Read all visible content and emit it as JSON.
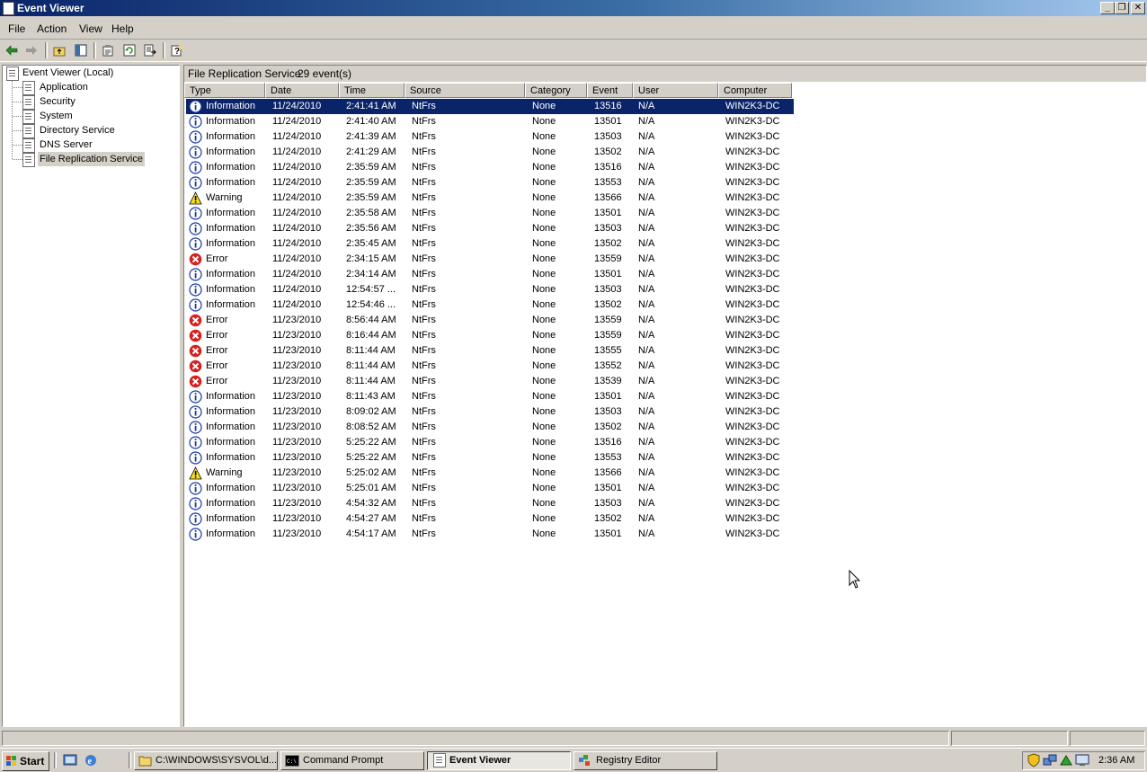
{
  "window": {
    "title": "Event Viewer"
  },
  "menu": [
    "File",
    "Action",
    "View",
    "Help"
  ],
  "tree": {
    "root": "Event Viewer (Local)",
    "children": [
      "Application",
      "Security",
      "System",
      "Directory Service",
      "DNS Server",
      "File Replication Service"
    ],
    "selected": "File Replication Service"
  },
  "panel": {
    "title": "File Replication Service",
    "count": "29 event(s)"
  },
  "columns": [
    "Type",
    "Date",
    "Time",
    "Source",
    "Category",
    "Event",
    "User",
    "Computer"
  ],
  "rows": [
    {
      "type": "Information",
      "date": "11/24/2010",
      "time": "2:41:41 AM",
      "source": "NtFrs",
      "category": "None",
      "event": "13516",
      "user": "N/A",
      "computer": "WIN2K3-DC"
    },
    {
      "type": "Information",
      "date": "11/24/2010",
      "time": "2:41:40 AM",
      "source": "NtFrs",
      "category": "None",
      "event": "13501",
      "user": "N/A",
      "computer": "WIN2K3-DC"
    },
    {
      "type": "Information",
      "date": "11/24/2010",
      "time": "2:41:39 AM",
      "source": "NtFrs",
      "category": "None",
      "event": "13503",
      "user": "N/A",
      "computer": "WIN2K3-DC"
    },
    {
      "type": "Information",
      "date": "11/24/2010",
      "time": "2:41:29 AM",
      "source": "NtFrs",
      "category": "None",
      "event": "13502",
      "user": "N/A",
      "computer": "WIN2K3-DC"
    },
    {
      "type": "Information",
      "date": "11/24/2010",
      "time": "2:35:59 AM",
      "source": "NtFrs",
      "category": "None",
      "event": "13516",
      "user": "N/A",
      "computer": "WIN2K3-DC"
    },
    {
      "type": "Information",
      "date": "11/24/2010",
      "time": "2:35:59 AM",
      "source": "NtFrs",
      "category": "None",
      "event": "13553",
      "user": "N/A",
      "computer": "WIN2K3-DC"
    },
    {
      "type": "Warning",
      "date": "11/24/2010",
      "time": "2:35:59 AM",
      "source": "NtFrs",
      "category": "None",
      "event": "13566",
      "user": "N/A",
      "computer": "WIN2K3-DC"
    },
    {
      "type": "Information",
      "date": "11/24/2010",
      "time": "2:35:58 AM",
      "source": "NtFrs",
      "category": "None",
      "event": "13501",
      "user": "N/A",
      "computer": "WIN2K3-DC"
    },
    {
      "type": "Information",
      "date": "11/24/2010",
      "time": "2:35:56 AM",
      "source": "NtFrs",
      "category": "None",
      "event": "13503",
      "user": "N/A",
      "computer": "WIN2K3-DC"
    },
    {
      "type": "Information",
      "date": "11/24/2010",
      "time": "2:35:45 AM",
      "source": "NtFrs",
      "category": "None",
      "event": "13502",
      "user": "N/A",
      "computer": "WIN2K3-DC"
    },
    {
      "type": "Error",
      "date": "11/24/2010",
      "time": "2:34:15 AM",
      "source": "NtFrs",
      "category": "None",
      "event": "13559",
      "user": "N/A",
      "computer": "WIN2K3-DC"
    },
    {
      "type": "Information",
      "date": "11/24/2010",
      "time": "2:34:14 AM",
      "source": "NtFrs",
      "category": "None",
      "event": "13501",
      "user": "N/A",
      "computer": "WIN2K3-DC"
    },
    {
      "type": "Information",
      "date": "11/24/2010",
      "time": "12:54:57 ...",
      "source": "NtFrs",
      "category": "None",
      "event": "13503",
      "user": "N/A",
      "computer": "WIN2K3-DC"
    },
    {
      "type": "Information",
      "date": "11/24/2010",
      "time": "12:54:46 ...",
      "source": "NtFrs",
      "category": "None",
      "event": "13502",
      "user": "N/A",
      "computer": "WIN2K3-DC"
    },
    {
      "type": "Error",
      "date": "11/23/2010",
      "time": "8:56:44 AM",
      "source": "NtFrs",
      "category": "None",
      "event": "13559",
      "user": "N/A",
      "computer": "WIN2K3-DC"
    },
    {
      "type": "Error",
      "date": "11/23/2010",
      "time": "8:16:44 AM",
      "source": "NtFrs",
      "category": "None",
      "event": "13559",
      "user": "N/A",
      "computer": "WIN2K3-DC"
    },
    {
      "type": "Error",
      "date": "11/23/2010",
      "time": "8:11:44 AM",
      "source": "NtFrs",
      "category": "None",
      "event": "13555",
      "user": "N/A",
      "computer": "WIN2K3-DC"
    },
    {
      "type": "Error",
      "date": "11/23/2010",
      "time": "8:11:44 AM",
      "source": "NtFrs",
      "category": "None",
      "event": "13552",
      "user": "N/A",
      "computer": "WIN2K3-DC"
    },
    {
      "type": "Error",
      "date": "11/23/2010",
      "time": "8:11:44 AM",
      "source": "NtFrs",
      "category": "None",
      "event": "13539",
      "user": "N/A",
      "computer": "WIN2K3-DC"
    },
    {
      "type": "Information",
      "date": "11/23/2010",
      "time": "8:11:43 AM",
      "source": "NtFrs",
      "category": "None",
      "event": "13501",
      "user": "N/A",
      "computer": "WIN2K3-DC"
    },
    {
      "type": "Information",
      "date": "11/23/2010",
      "time": "8:09:02 AM",
      "source": "NtFrs",
      "category": "None",
      "event": "13503",
      "user": "N/A",
      "computer": "WIN2K3-DC"
    },
    {
      "type": "Information",
      "date": "11/23/2010",
      "time": "8:08:52 AM",
      "source": "NtFrs",
      "category": "None",
      "event": "13502",
      "user": "N/A",
      "computer": "WIN2K3-DC"
    },
    {
      "type": "Information",
      "date": "11/23/2010",
      "time": "5:25:22 AM",
      "source": "NtFrs",
      "category": "None",
      "event": "13516",
      "user": "N/A",
      "computer": "WIN2K3-DC"
    },
    {
      "type": "Information",
      "date": "11/23/2010",
      "time": "5:25:22 AM",
      "source": "NtFrs",
      "category": "None",
      "event": "13553",
      "user": "N/A",
      "computer": "WIN2K3-DC"
    },
    {
      "type": "Warning",
      "date": "11/23/2010",
      "time": "5:25:02 AM",
      "source": "NtFrs",
      "category": "None",
      "event": "13566",
      "user": "N/A",
      "computer": "WIN2K3-DC"
    },
    {
      "type": "Information",
      "date": "11/23/2010",
      "time": "5:25:01 AM",
      "source": "NtFrs",
      "category": "None",
      "event": "13501",
      "user": "N/A",
      "computer": "WIN2K3-DC"
    },
    {
      "type": "Information",
      "date": "11/23/2010",
      "time": "4:54:32 AM",
      "source": "NtFrs",
      "category": "None",
      "event": "13503",
      "user": "N/A",
      "computer": "WIN2K3-DC"
    },
    {
      "type": "Information",
      "date": "11/23/2010",
      "time": "4:54:27 AM",
      "source": "NtFrs",
      "category": "None",
      "event": "13502",
      "user": "N/A",
      "computer": "WIN2K3-DC"
    },
    {
      "type": "Information",
      "date": "11/23/2010",
      "time": "4:54:17 AM",
      "source": "NtFrs",
      "category": "None",
      "event": "13501",
      "user": "N/A",
      "computer": "WIN2K3-DC"
    }
  ],
  "taskbar": {
    "start": "Start",
    "tasks": [
      "C:\\WINDOWS\\SYSVOL\\d...",
      "Command Prompt",
      "Event Viewer",
      "Registry Editor"
    ],
    "active_task": "Event Viewer",
    "clock": "2:36 AM"
  },
  "colors": {
    "selection": "#0a246a",
    "titlebar": "#0a246a",
    "face": "#d4d0c8"
  },
  "icons": {
    "information": "info-icon",
    "warning": "warning-icon",
    "error": "error-icon"
  }
}
